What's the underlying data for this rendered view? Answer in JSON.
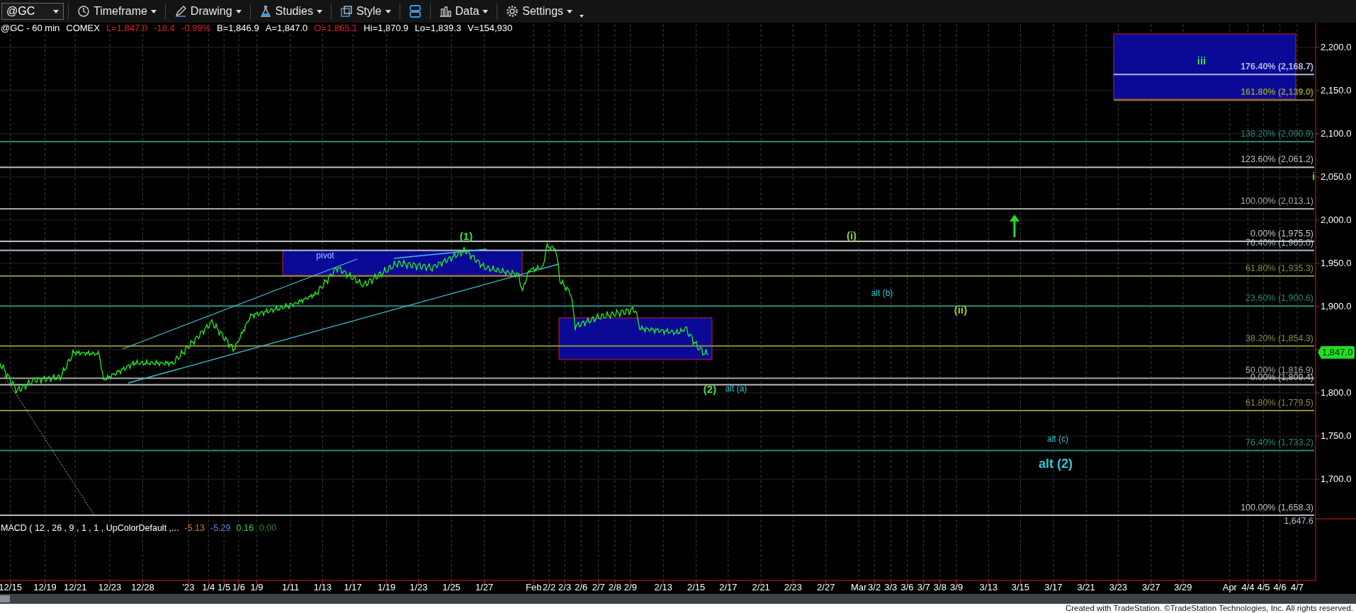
{
  "toolbar": {
    "symbol": "@GC",
    "menus": [
      "Timeframe",
      "Drawing",
      "Studies",
      "Style",
      "Data",
      "Settings"
    ]
  },
  "quote_line": [
    {
      "text": "@GC - 60 min",
      "color": "#ffffff"
    },
    {
      "text": "COMEX",
      "color": "#ffffff"
    },
    {
      "text": "L=1,847.0",
      "color": "#e02020"
    },
    {
      "text": "-18.4",
      "color": "#e02020"
    },
    {
      "text": "-0.99%",
      "color": "#e02020"
    },
    {
      "text": "B=1,846.9",
      "color": "#ffffff"
    },
    {
      "text": "A=1,847.0",
      "color": "#ffffff"
    },
    {
      "text": "O=1,865.1",
      "color": "#e02020"
    },
    {
      "text": "Hi=1,870.9",
      "color": "#ffffff"
    },
    {
      "text": "Lo=1,839.3",
      "color": "#ffffff"
    },
    {
      "text": "V=154,930",
      "color": "#ffffff"
    }
  ],
  "price_axis": [
    "2,200.0",
    "2,150.0",
    "2,100.0",
    "2,050.0",
    "2,000.0",
    "1,950.0",
    "1,900.0",
    "1,800.0",
    "1,750.0",
    "1,700.0"
  ],
  "last_price": "1,847.0",
  "fib_levels": [
    {
      "label": "176.40% (2,168.7)",
      "color": "#b4b4e8"
    },
    {
      "label": "161.80% (2,139.0)",
      "color": "#8c8c40"
    },
    {
      "label": "138.20% (2,090.9)",
      "color": "#2a8a78"
    },
    {
      "label": "123.60% (2,061.2)",
      "color": "#c0c0c0"
    },
    {
      "label": "100.00% (2,013.1)",
      "color": "#a8a8a8"
    },
    {
      "label": "0.00% (1,975.5)",
      "color": "#c8c8c8"
    },
    {
      "label": "76.40% (1,965.0)",
      "color": "#b0bcd0"
    },
    {
      "label": "61.80% (1,935.3)",
      "color": "#8c8c40"
    },
    {
      "label": "23.60% (1,900.6)",
      "color": "#2a8a78"
    },
    {
      "label": "38.20% (1,854.3)",
      "color": "#8c8c40"
    },
    {
      "label": "50.00% (1,816.9)",
      "color": "#a8a8a8"
    },
    {
      "label": "0.00% (1,809.4)",
      "color": "#c0c0c0"
    },
    {
      "label": "61.80% (1,779.5)",
      "color": "#8c8c40"
    },
    {
      "label": "76.40% (1,733.2)",
      "color": "#2a8a78"
    },
    {
      "label": "100.00% (1,658.3)",
      "color": "#c0c0c0"
    }
  ],
  "axis_low_label": "1,647.6",
  "wave_labels": [
    {
      "text": "(1)",
      "kind": "wave",
      "color": "#44dd44"
    },
    {
      "text": "pivot",
      "kind": "alt",
      "color": "#a0c8ff"
    },
    {
      "text": "(i)",
      "kind": "wave",
      "color": "#99cc33"
    },
    {
      "text": "alt (b)",
      "kind": "alt",
      "color": "#30c8d8"
    },
    {
      "text": "(ii)",
      "kind": "wave",
      "color": "#99cc33"
    },
    {
      "text": "(2)",
      "kind": "wave",
      "color": "#44dd44"
    },
    {
      "text": "alt (a)",
      "kind": "alt",
      "color": "#30c8d8"
    },
    {
      "text": "iii",
      "kind": "wave",
      "color": "#44dd44"
    },
    {
      "text": "i",
      "kind": "wave",
      "color": "#44dd44"
    },
    {
      "text": "alt (c)",
      "kind": "alt",
      "color": "#30c8d8"
    },
    {
      "text": "alt (2)",
      "kind": "major",
      "color": "#30c8d8"
    }
  ],
  "macd": {
    "label": "MACD ( 12 , 26 , 9 , 1 , 1 , UpColorDefault ,...",
    "values": [
      {
        "text": "-5.13",
        "color": "#e07a30"
      },
      {
        "text": "-5.29",
        "color": "#5a8ae0"
      },
      {
        "text": "0.16",
        "color": "#40d040"
      },
      {
        "text": "0.00",
        "color": "#2a8a2a"
      }
    ]
  },
  "date_axis": [
    "12/15",
    "12/19",
    "12/21",
    "12/23",
    "12/28",
    "'23",
    "1/4",
    "1/5",
    "1/6",
    "1/9",
    "1/11",
    "1/13",
    "1/17",
    "1/19",
    "1/23",
    "1/25",
    "1/27",
    "Feb",
    "2/2",
    "2/3",
    "2/6",
    "2/7",
    "2/8",
    "2/9",
    "2/13",
    "2/15",
    "2/17",
    "2/21",
    "2/23",
    "2/27",
    "Mar",
    "3/2",
    "3/3",
    "3/6",
    "3/7",
    "3/8",
    "3/9",
    "3/13",
    "3/15",
    "3/17",
    "3/21",
    "3/23",
    "3/27",
    "3/29",
    "Apr",
    "4/4",
    "4/5",
    "4/6",
    "4/7"
  ],
  "footer": "Created with TradeStation. ©TradeStation Technologies, Inc. All rights reserved."
}
